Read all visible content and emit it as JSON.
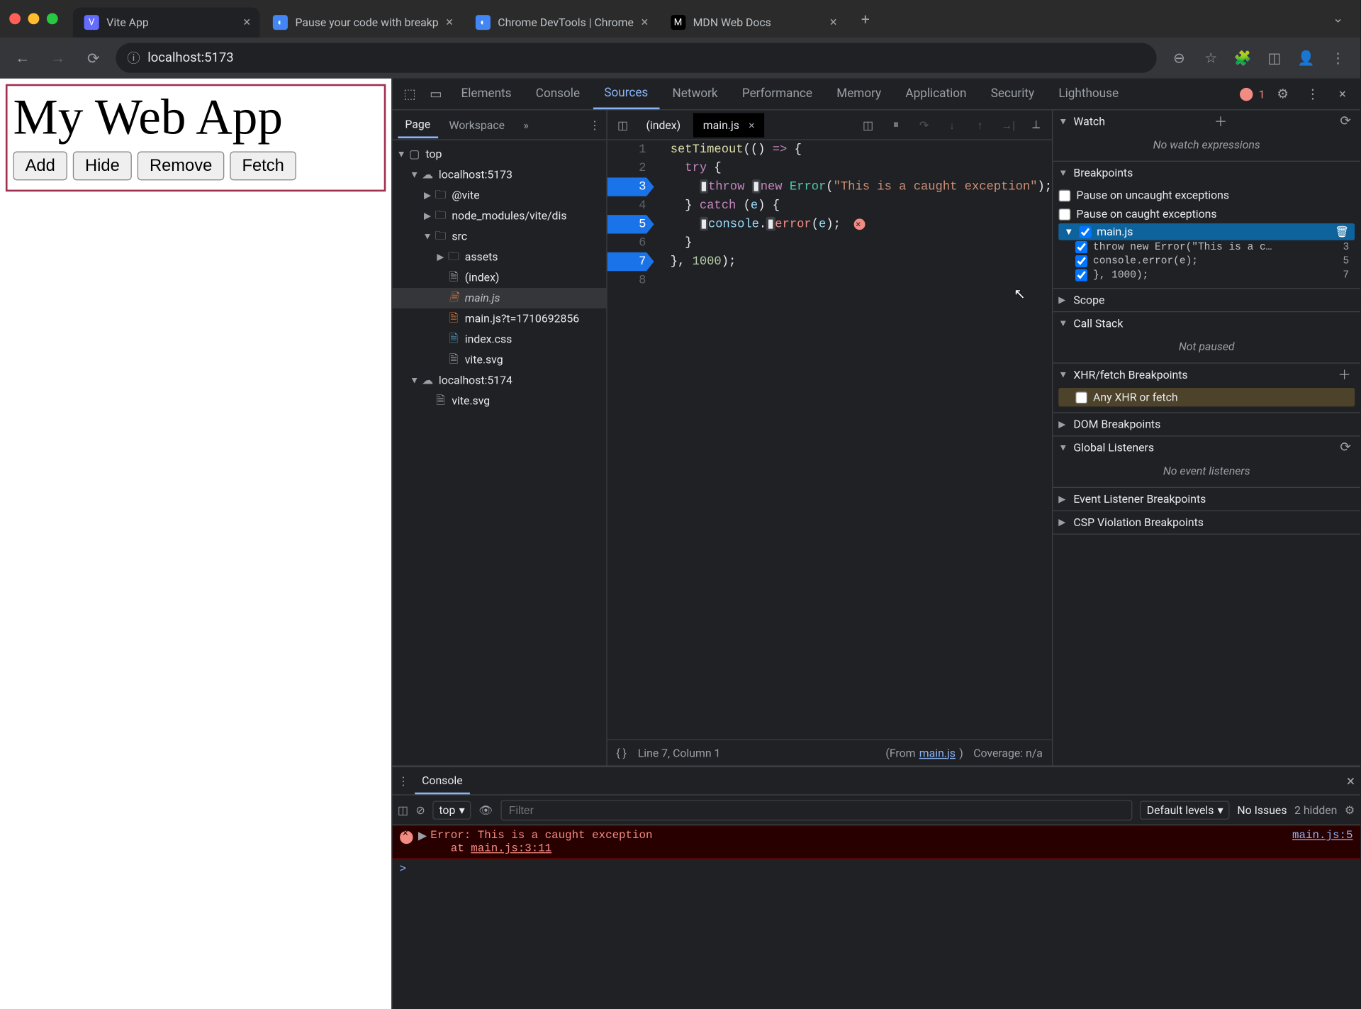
{
  "window": {
    "tabs": [
      {
        "title": "Vite App",
        "favicon_bg": "#646cff"
      },
      {
        "title": "Pause your code with breakp",
        "favicon_bg": "#4285f4"
      },
      {
        "title": "Chrome DevTools | Chrome",
        "favicon_bg": "#4285f4"
      },
      {
        "title": "MDN Web Docs",
        "favicon_bg": "#000"
      }
    ],
    "url": "localhost:5173"
  },
  "page": {
    "title": "My Web App",
    "buttons": [
      "Add",
      "Hide",
      "Remove",
      "Fetch"
    ]
  },
  "devtools": {
    "panels": [
      "Elements",
      "Console",
      "Sources",
      "Network",
      "Performance",
      "Memory",
      "Application",
      "Security",
      "Lighthouse"
    ],
    "active_panel": "Sources",
    "error_count": "1",
    "navigator": {
      "tabs": [
        "Page",
        "Workspace"
      ],
      "overflow": "»",
      "tree": [
        {
          "indent": 0,
          "arrow": "▼",
          "icon": "window",
          "label": "top"
        },
        {
          "indent": 1,
          "arrow": "▼",
          "icon": "cloud",
          "label": "localhost:5173"
        },
        {
          "indent": 2,
          "arrow": "▶",
          "icon": "folder",
          "label": "@vite"
        },
        {
          "indent": 2,
          "arrow": "▶",
          "icon": "folder",
          "label": "node_modules/vite/dis"
        },
        {
          "indent": 2,
          "arrow": "▼",
          "icon": "folder",
          "label": "src"
        },
        {
          "indent": 3,
          "arrow": "▶",
          "icon": "folder",
          "label": "assets"
        },
        {
          "indent": 3,
          "arrow": "",
          "icon": "file",
          "label": "(index)"
        },
        {
          "indent": 3,
          "arrow": "",
          "icon": "js",
          "label": "main.js",
          "italic": true,
          "selected": true
        },
        {
          "indent": 3,
          "arrow": "",
          "icon": "js",
          "label": "main.js?t=1710692856"
        },
        {
          "indent": 3,
          "arrow": "",
          "icon": "css",
          "label": "index.css"
        },
        {
          "indent": 3,
          "arrow": "",
          "icon": "file",
          "label": "vite.svg"
        },
        {
          "indent": 1,
          "arrow": "▼",
          "icon": "cloud",
          "label": "localhost:5174"
        },
        {
          "indent": 2,
          "arrow": "",
          "icon": "file",
          "label": "vite.svg"
        }
      ]
    },
    "editor": {
      "tabs": [
        {
          "label": "(index)"
        },
        {
          "label": "main.js",
          "active": true,
          "closable": true
        }
      ],
      "lines": {
        "1": "setTimeout(() => {",
        "2": "  try {",
        "3": "    throw new Error(\"This is a caught exception\");",
        "4": "  } catch (e) {",
        "5": "    console.error(e);",
        "6": "  }",
        "7": "}, 1000);",
        "8": ""
      },
      "breakpoint_lines": [
        3,
        5,
        7
      ],
      "status_left": "Line 7, Column 1",
      "status_from": "(From ",
      "status_link": "main.js",
      "status_close": ")",
      "status_coverage": "Coverage: n/a"
    },
    "debugger": {
      "watch": {
        "title": "Watch",
        "empty": "No watch expressions"
      },
      "breakpoints": {
        "title": "Breakpoints",
        "uncaught": {
          "label": "Pause on uncaught exceptions",
          "checked": false
        },
        "caught": {
          "label": "Pause on caught exceptions",
          "checked": false
        },
        "file": "main.js",
        "items": [
          {
            "text": "throw new Error(\"This is a c…",
            "line": "3",
            "checked": true
          },
          {
            "text": "console.error(e);",
            "line": "5",
            "checked": true
          },
          {
            "text": "}, 1000);",
            "line": "7",
            "checked": true
          }
        ]
      },
      "scope": {
        "title": "Scope"
      },
      "callstack": {
        "title": "Call Stack",
        "empty": "Not paused"
      },
      "xhr": {
        "title": "XHR/fetch Breakpoints",
        "any": "Any XHR or fetch",
        "checked": false
      },
      "dom": {
        "title": "DOM Breakpoints"
      },
      "global": {
        "title": "Global Listeners",
        "empty": "No event listeners"
      },
      "eventbp": {
        "title": "Event Listener Breakpoints"
      },
      "cspbp": {
        "title": "CSP Violation Breakpoints"
      }
    },
    "console": {
      "tab": "Console",
      "context": "top",
      "filter_placeholder": "Filter",
      "levels": "Default levels",
      "issues": "No Issues",
      "hidden": "2 hidden",
      "error": {
        "msg_line1": "Error: This is a caught exception",
        "msg_line2": "   at ",
        "stack_link": "main.js:3:11",
        "source": "main.js:5"
      },
      "prompt": ">"
    }
  }
}
